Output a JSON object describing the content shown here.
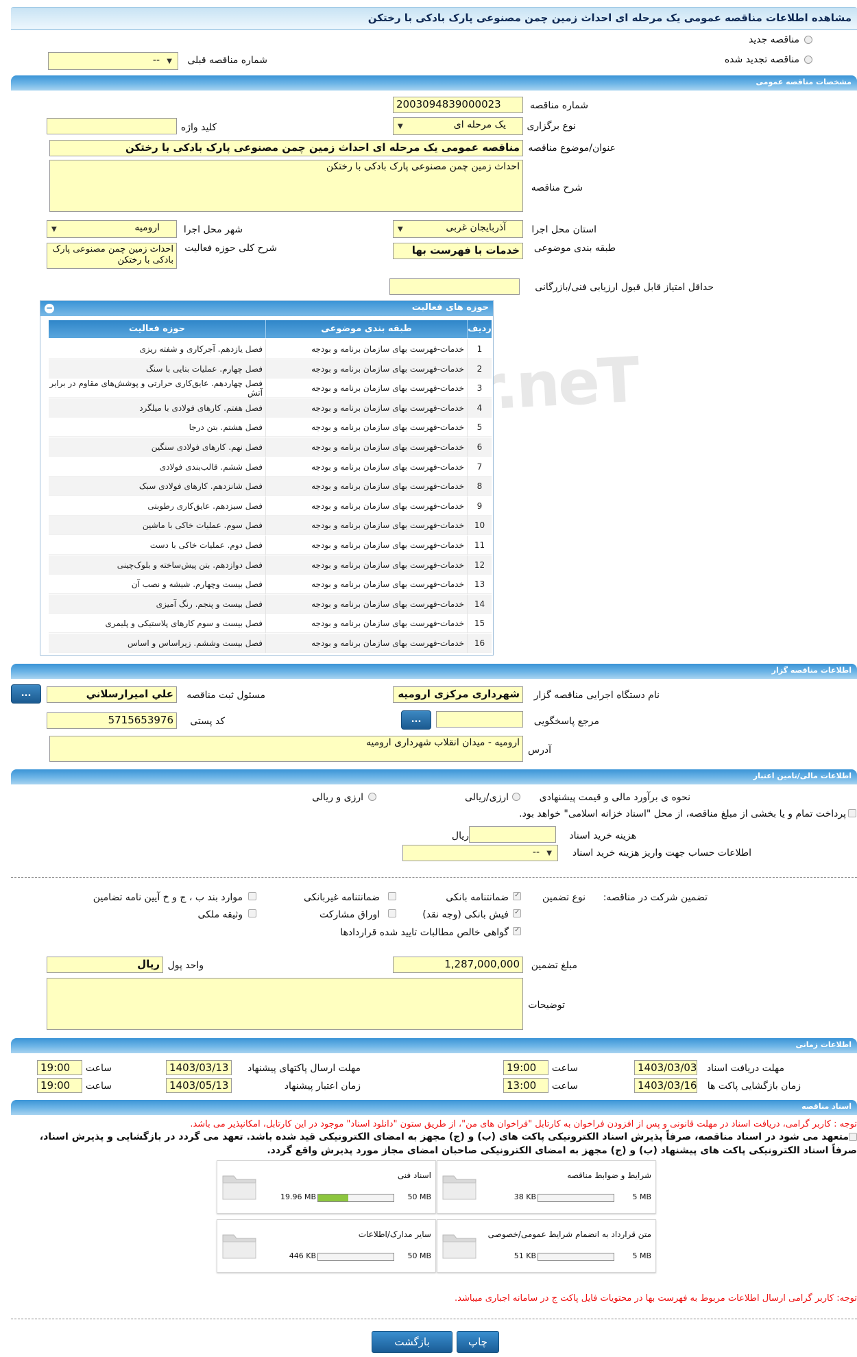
{
  "page_title": "مشاهده اطلاعات مناقصه عمومی یک مرحله ای احداث زمین چمن مصنوعی پارک بادکی با رختکن",
  "watermark": "ariatender.neT",
  "top": {
    "new_tender": "مناقصه جدید",
    "renewed_tender": "مناقصه تجدید شده",
    "prev_number_label": "شماره مناقصه قبلی",
    "prev_number_value": "--"
  },
  "general": {
    "section": "مشخصات مناقصه عمومی",
    "number_label": "شماره مناقصه",
    "number_value": "2003094839000023",
    "type_label": "نوع برگزاری",
    "type_value": "یک مرحله ای",
    "keyword_label": "کلید واژه",
    "keyword_value": "",
    "subject_label": "عنوان/موضوع مناقصه",
    "subject_value": "مناقصه عمومی یک مرحله ای احداث زمین چمن مصنوعی پارک بادکی  با رختکن",
    "desc_label": "شرح مناقصه",
    "desc_value": "احداث زمین چمن مصنوعی پارک بادکی  با رختکن",
    "province_label": "استان محل اجرا",
    "province_value": "آذربایجان غربی",
    "city_label": "شهر محل اجرا",
    "city_value": "ارومیه",
    "category_label": "طبقه بندی موضوعی",
    "category_value": "خدمات با فهرست بها",
    "activity_label": "شرح کلی حوزه فعالیت",
    "activity_value": "احداث زمین چمن مصنوعی پارک بادکی  با رختکن",
    "min_score_label": "حداقل امتیاز قابل قبول ارزیابی فنی/بازرگانی",
    "min_score_value": ""
  },
  "activity_grid": {
    "title": "حوزه های فعالیت",
    "col_row": "ردیف",
    "col_category": "طبقه بندی موضوعی",
    "col_field": "حوزه فعالیت",
    "rows": [
      {
        "n": "1",
        "cat": "خدمات-فهرست بهای سازمان برنامه و بودجه",
        "field": "فصل یازدهم. آجرکاری و شفته ریزی"
      },
      {
        "n": "2",
        "cat": "خدمات-فهرست بهای سازمان برنامه و بودجه",
        "field": "فصل چهارم. عملیات بنایی با سنگ"
      },
      {
        "n": "3",
        "cat": "خدمات-فهرست بهای سازمان برنامه و بودجه",
        "field": "فصل چهاردهم. عایق‌کاری حرارتی و پوشش‌های مقاوم در برابر آتش"
      },
      {
        "n": "4",
        "cat": "خدمات-فهرست بهای سازمان برنامه و بودجه",
        "field": "فصل هفتم. کارهای فولادی با میلگرد"
      },
      {
        "n": "5",
        "cat": "خدمات-فهرست بهای سازمان برنامه و بودجه",
        "field": "فصل هشتم. بتن درجا"
      },
      {
        "n": "6",
        "cat": "خدمات-فهرست بهای سازمان برنامه و بودجه",
        "field": "فصل نهم. کارهای فولادی سنگین"
      },
      {
        "n": "7",
        "cat": "خدمات-فهرست بهای سازمان برنامه و بودجه",
        "field": "فصل ششم. قالب‌بندی فولادی"
      },
      {
        "n": "8",
        "cat": "خدمات-فهرست بهای سازمان برنامه و بودجه",
        "field": "فصل شانزدهم. کارهای فولادی سبک"
      },
      {
        "n": "9",
        "cat": "خدمات-فهرست بهای سازمان برنامه و بودجه",
        "field": "فصل سیزدهم. عایق‌کاری رطوبتی"
      },
      {
        "n": "10",
        "cat": "خدمات-فهرست بهای سازمان برنامه و بودجه",
        "field": "فصل سوم. عملیات خاکی با ماشین"
      },
      {
        "n": "11",
        "cat": "خدمات-فهرست بهای سازمان برنامه و بودجه",
        "field": "فصل دوم. عملیات خاکی با دست"
      },
      {
        "n": "12",
        "cat": "خدمات-فهرست بهای سازمان برنامه و بودجه",
        "field": "فصل دوازدهم. بتن پیش‌ساخته و بلوک‌چینی"
      },
      {
        "n": "13",
        "cat": "خدمات-فهرست بهای سازمان برنامه و بودجه",
        "field": "فصل بیست وچهارم. شیشه و نصب آن"
      },
      {
        "n": "14",
        "cat": "خدمات-فهرست بهای سازمان برنامه و بودجه",
        "field": "فصل بیست و پنجم. رنگ آمیزی"
      },
      {
        "n": "15",
        "cat": "خدمات-فهرست بهای سازمان برنامه و بودجه",
        "field": "فصل بیست و سوم کارهای پلاستیکی و پلیمری"
      },
      {
        "n": "16",
        "cat": "خدمات-فهرست بهای سازمان برنامه و بودجه",
        "field": "فصل بیست وششم. زیراساس و اساس"
      }
    ]
  },
  "organizer": {
    "section": "اطلاعات مناقصه گزار",
    "org_label": "نام دستگاه اجرایی مناقصه گزار",
    "org_value": "شهرداری مرکزی ارومیه",
    "registrar_label": "مسئول ثبت مناقصه",
    "registrar_value": "علي اميرارسلاني",
    "ref_label": "مرجع پاسخگویی",
    "ref_value": "",
    "postal_label": "کد پستی",
    "postal_value": "5715653976",
    "address_label": "آدرس",
    "address_value": "ارومیه - میدان انقلاب شهرداری ارومیه",
    "dots": "..."
  },
  "finance": {
    "section": "اطلاعات مالی/تامین اعتبار",
    "estimate_label": "نحوه ی برآورد مالی و قیمت پیشنهادی",
    "opt_currency": "ارزی/ریالی",
    "opt_currency_rial": "ارزی و ریالی",
    "treasury_note": "پرداخت تمام و یا بخشی از مبلغ مناقصه، از محل \"اسناد خزانه اسلامی\" خواهد بود.",
    "doc_cost_label": "هزینه خرید اسناد",
    "doc_cost_unit": "ریال",
    "doc_cost_value": "",
    "account_label": "اطلاعات حساب جهت واریز هزینه خرید اسناد",
    "account_value": "--"
  },
  "guarantee": {
    "participation_label": "تضمین شرکت در مناقصه:",
    "type_label": "نوع تضمین",
    "bank_guarantee": "ضمانتنامه بانکی",
    "non_bank_guarantee": "ضمانتنامه غیربانکی",
    "clauses": "موارد بند ب ، ج و خ آیین نامه تضامین",
    "bank_receipt": "فیش بانکی (وجه نقد)",
    "participation_bonds": "اوراق مشارکت",
    "property_pledge": "وثیقه ملکی",
    "claims_cert": "گواهی خالص مطالبات تایید شده قراردادها",
    "amount_label": "مبلغ تضمین",
    "amount_value": "1,287,000,000",
    "currency_label": "واحد پول",
    "currency_value": "ریال",
    "notes_label": "توضیحات",
    "notes_value": ""
  },
  "timing": {
    "section": "اطلاعات زمانی",
    "doc_receive_label": "مهلت دریافت اسناد",
    "doc_receive_date": "1403/03/03",
    "doc_receive_time": "19:00",
    "send_label": "مهلت ارسال پاکتهای پیشنهاد",
    "send_date": "1403/03/13",
    "send_time": "19:00",
    "open_label": "زمان بازگشایی پاکت ها",
    "open_date": "1403/03/16",
    "open_time": "13:00",
    "validity_label": "زمان اعتبار پیشنهاد",
    "validity_date": "1403/05/13",
    "validity_time": "19:00",
    "time_label": "ساعت"
  },
  "documents": {
    "section": "اسناد مناقصه",
    "note1": "توجه : کاربر گرامی، دریافت اسناد در مهلت قانونی و پس از افزودن فراخوان به کارتابل \"فراخوان های من\"، از طریق ستون \"دانلود اسناد\" موجود در این کارتابل، امکانپذیر می باشد.",
    "commit1": "متعهد می شود در اسناد مناقصه، صرفاً پذیرش اسناد الکترونیکی پاکت های (ب) و (ج) مجهز به امضای الکترونیکی قید شده باشد. تعهد می گردد در بازگشایی و پذیرش اسناد،",
    "commit2": "صرفاً اسناد الکترونیکی پاکت های پیشنهاد (ب) و (ج) مجهز به امضای الکترونیکی صاحبان امضای مجاز مورد پذیرش واقع گردد.",
    "files": [
      {
        "name": "اسناد فنی",
        "max": "50 MB",
        "size": "19.96 MB",
        "fill": 0.4
      },
      {
        "name": "شرایط و ضوابط مناقصه",
        "max": "5 MB",
        "size": "38 KB",
        "fill": 0.0
      },
      {
        "name": "سایر مدارک/اطلاعات",
        "max": "50 MB",
        "size": "446 KB",
        "fill": 0.0
      },
      {
        "name": "متن قرارداد به انضمام شرایط عمومی/خصوصی",
        "max": "5 MB",
        "size": "51 KB",
        "fill": 0.0
      }
    ],
    "note2": "توجه: کاربر گرامی ارسال اطلاعات مربوط به فهرست بها در محتویات فایل پاکت ج در سامانه اجباری میباشد."
  },
  "buttons": {
    "print": "چاپ",
    "back": "بازگشت"
  },
  "colors": {
    "input_bg": "#ffffc0",
    "section_blue": "#3a94d6",
    "progress_green": "#8dc63f",
    "note_red": "#e11111"
  }
}
